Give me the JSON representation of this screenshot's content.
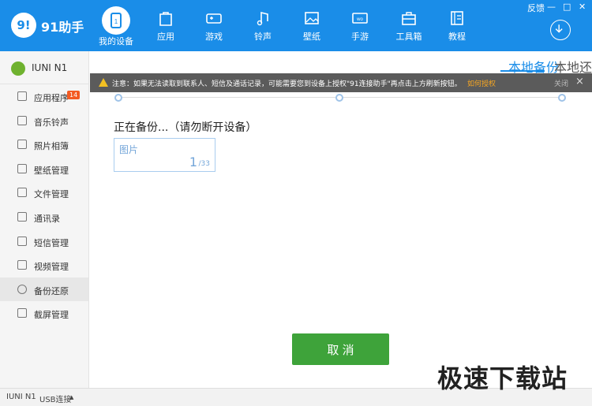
{
  "app": {
    "logo_char": "9!",
    "title": "91助手"
  },
  "window": {
    "feedback": "反馈",
    "minimize": "—",
    "restore": "□",
    "close": "✕"
  },
  "nav": [
    {
      "label": "我的设备",
      "icon": "phone-icon",
      "active": true
    },
    {
      "label": "应用",
      "icon": "bag-icon"
    },
    {
      "label": "游戏",
      "icon": "gamepad-icon"
    },
    {
      "label": "铃声",
      "icon": "music-icon"
    },
    {
      "label": "壁纸",
      "icon": "image-icon"
    },
    {
      "label": "手游",
      "icon": "handheld-icon"
    },
    {
      "label": "工具箱",
      "icon": "toolbox-icon"
    },
    {
      "label": "教程",
      "icon": "book-icon"
    }
  ],
  "device": {
    "name": "IUNI N1"
  },
  "sidebar": [
    {
      "label": "应用程序",
      "badge": "14"
    },
    {
      "label": "音乐铃声"
    },
    {
      "label": "照片相簿"
    },
    {
      "label": "壁纸管理"
    },
    {
      "label": "文件管理"
    },
    {
      "label": "通讯录"
    },
    {
      "label": "短信管理"
    },
    {
      "label": "视频管理"
    },
    {
      "label": "备份还原",
      "active": true
    },
    {
      "label": "截屏管理"
    }
  ],
  "tabs": {
    "local_backup": "本地备份",
    "local_restore": "本地还原"
  },
  "warning": {
    "text": "注意：如果无法读取到联系人、短信及通话记录，可能需要您到设备上授权\"91连接助手\"再点击上方刷新按钮。",
    "link": "如何授权",
    "dismiss": "关闭"
  },
  "backup": {
    "heading": "正在备份...（请勿断开设备）",
    "item_title": "图片",
    "current": "1",
    "total": "/33"
  },
  "cancel_label": "取 消",
  "status": {
    "device": "IUNI N1",
    "connection": "USB连接",
    "arrow": "▲"
  },
  "watermark": "极速下载站",
  "colors": {
    "brand": "#1a8de8",
    "cancel": "#3ea33a",
    "warning_link": "#f5a623",
    "badge": "#f35a22"
  }
}
